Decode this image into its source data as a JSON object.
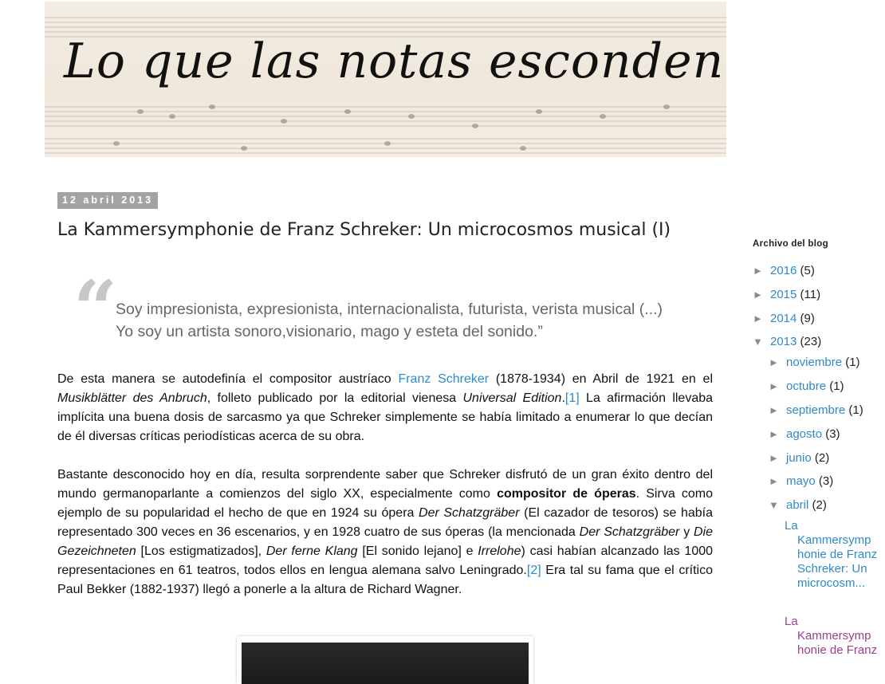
{
  "blog": {
    "title": "Lo que las notas esconden"
  },
  "post": {
    "date": "12 abril 2013",
    "title": "La Kammersymphonie de Franz Schreker: Un microcosmos musical (I)",
    "quote": "Soy impresionista, expresionista, internacionalista, futurista, verista musical (...) Yo soy un artista sonoro,visionario, mago y esteta del sonido.”",
    "p1": {
      "t1": "De esta manera se autodefinía el compositor austríaco ",
      "link": "Franz Schreker",
      "t2": " (1878-1934) en Abril de 1921 en el ",
      "em1": "Musikblätter des Anbruch",
      "t3": ", folleto publicado por la editorial vienesa ",
      "em2": "Universal Edition",
      "t4": ".",
      "ref": "[1]",
      "t5": " La afirmación llevaba implícita una buena dosis de sarcasmo ya que Schreker simplemente se había limitado a enumerar lo que decían de él diversas críticas periodísticas acerca de su obra."
    },
    "p2": {
      "t1": "Bastante desconocido hoy en día, resulta sorprendente saber que Schreker disfrutó de un gran éxito dentro del mundo germanoparlante  a comienzos del siglo XX, especialmente como ",
      "b1": "compositor de óperas",
      "t2": ". Sirva como ejemplo de su popularidad el hecho de que en 1924 su ópera ",
      "em1": "Der Schatzgräber",
      "t3": " (El cazador de tesoros) se había representado 300 veces en 36 escenarios, y en 1928 cuatro de sus óperas (la mencionada ",
      "em2": "Der Schatzgräber",
      "t4": " y ",
      "em3": "Die Gezeichneten",
      "t5": "  [Los estigmatizados], ",
      "em4": "Der ferne Klang",
      "t6": " [El sonido lejano] e ",
      "em5": "Irrelohe",
      "t7": ") casi habían alcanzado las 1000 representaciones en 61 teatros, todos ellos en lengua alemana salvo Leningrado.",
      "ref": "[2]",
      "t8": " Era tal su fama que el crítico Paul Bekker (1882-1937) llegó a ponerle a la altura de Richard Wagner."
    }
  },
  "sidebar": {
    "archive_title": "Archivo del blog",
    "years": [
      {
        "year": "2016",
        "count": "(5)",
        "arrow": "►"
      },
      {
        "year": "2015",
        "count": "(11)",
        "arrow": "►"
      },
      {
        "year": "2014",
        "count": "(9)",
        "arrow": "►"
      },
      {
        "year": "2013",
        "count": "(23)",
        "arrow": "▼"
      }
    ],
    "months": [
      {
        "month": "noviembre",
        "count": "(1)",
        "arrow": "►"
      },
      {
        "month": "octubre",
        "count": "(1)",
        "arrow": "►"
      },
      {
        "month": "septiembre",
        "count": "(1)",
        "arrow": "►"
      },
      {
        "month": "agosto",
        "count": "(3)",
        "arrow": "►"
      },
      {
        "month": "junio",
        "count": "(2)",
        "arrow": "►"
      },
      {
        "month": "mayo",
        "count": "(3)",
        "arrow": "►"
      },
      {
        "month": "abril",
        "count": "(2)",
        "arrow": "▼"
      }
    ],
    "posts": [
      {
        "lead": "La",
        "rest": "Kammersymp honie de Franz Schreker: Un microcosm..."
      },
      {
        "lead": "La",
        "rest": "Kammersymp honie de Franz"
      }
    ]
  },
  "colors": {
    "link": "#2f8ac7",
    "visited_link": "#9b3f8c",
    "date_badge": "#a3a3a3"
  }
}
